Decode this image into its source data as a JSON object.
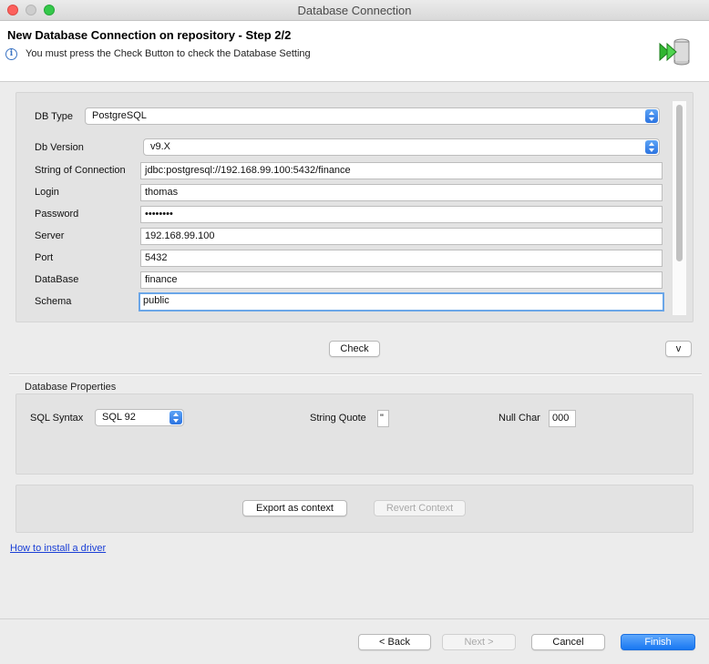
{
  "window": {
    "title": "Database Connection"
  },
  "header": {
    "title": "New Database Connection on repository - Step 2/2",
    "message": "You must press the Check Button to check the Database Setting"
  },
  "form": {
    "db_type": {
      "label": "DB Type",
      "value": "PostgreSQL"
    },
    "db_version": {
      "label": "Db Version",
      "value": "v9.X"
    },
    "connection_string": {
      "label": "String of Connection",
      "value": "jdbc:postgresql://192.168.99.100:5432/finance"
    },
    "login": {
      "label": "Login",
      "value": "thomas"
    },
    "password": {
      "label": "Password",
      "value": "••••••••"
    },
    "server": {
      "label": "Server",
      "value": "192.168.99.100"
    },
    "port": {
      "label": "Port",
      "value": "5432"
    },
    "database": {
      "label": "DataBase",
      "value": "finance"
    },
    "schema": {
      "label": "Schema",
      "value": "public"
    }
  },
  "check_button": "Check",
  "expand_button": "v",
  "properties": {
    "title": "Database Properties",
    "sql_syntax": {
      "label": "SQL Syntax",
      "value": "SQL 92"
    },
    "string_quote": {
      "label": "String Quote",
      "value": "\""
    },
    "null_char": {
      "label": "Null Char",
      "value": "000"
    }
  },
  "context": {
    "export_label": "Export as context",
    "revert_label": "Revert Context"
  },
  "install_driver_link": "How to install a driver",
  "footer": {
    "back": "< Back",
    "next": "Next >",
    "cancel": "Cancel",
    "finish": "Finish"
  },
  "colors": {
    "accent": "#1877f2",
    "link": "#1a3fd6",
    "focus_ring": "#6aa6e8"
  },
  "icons": {
    "info": "info-icon",
    "db_logo": "database-wizard-icon",
    "select_arrow": "select-updown-icon"
  }
}
